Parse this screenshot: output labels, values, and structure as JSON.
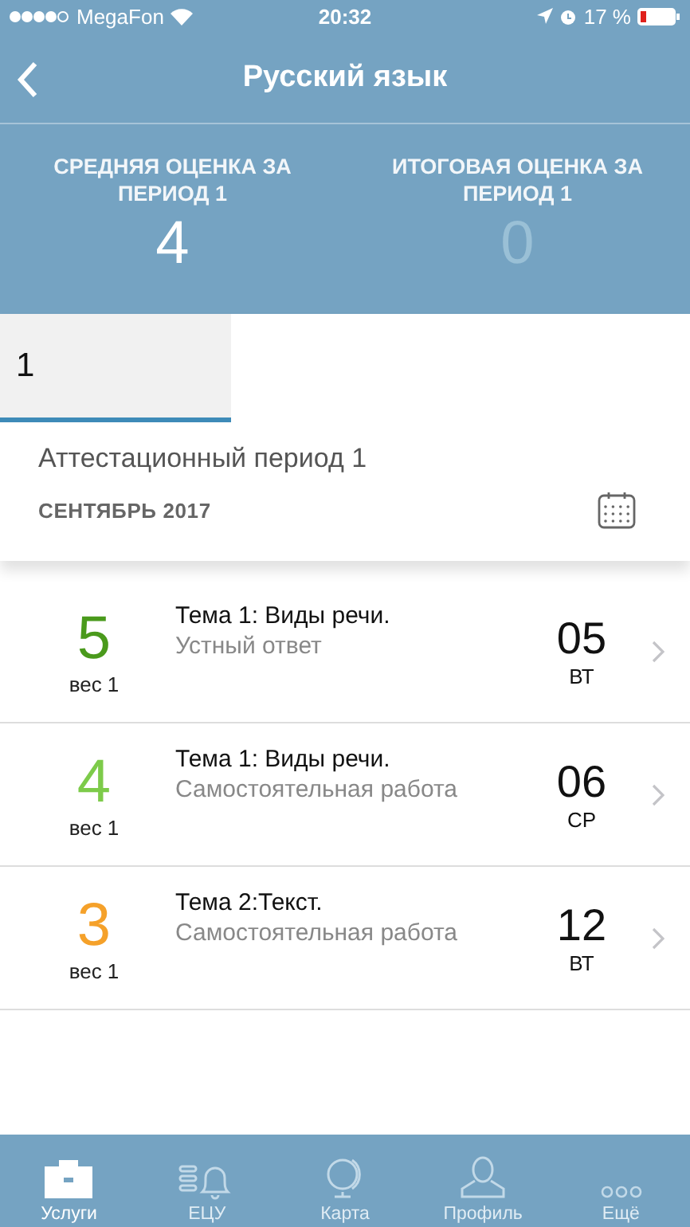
{
  "status_bar": {
    "carrier": "MegaFon",
    "time": "20:32",
    "battery": "17 %"
  },
  "nav": {
    "title": "Русский язык"
  },
  "summary": [
    {
      "label": "СРЕДНЯЯ ОЦЕНКА ЗА ПЕРИОД 1",
      "value": "4",
      "dimmed": false
    },
    {
      "label": "ИТОГОВАЯ ОЦЕНКА ЗА ПЕРИОД 1",
      "value": "0",
      "dimmed": true
    }
  ],
  "periods": [
    {
      "label": "1",
      "selected": true
    }
  ],
  "period_title": "Аттестационный период 1",
  "month": "СЕНТЯБРЬ 2017",
  "grades": [
    {
      "grade": "5",
      "color": "#4a9a1c",
      "weight": "вес 1",
      "topic": "Тема 1: Виды речи.",
      "type": "Устный ответ",
      "day": "05",
      "weekday": "ВТ"
    },
    {
      "grade": "4",
      "color": "#7dcb4a",
      "weight": "вес 1",
      "topic": "Тема 1: Виды речи.",
      "type": "Самостоятельная работа",
      "day": "06",
      "weekday": "СР"
    },
    {
      "grade": "3",
      "color": "#f5a12a",
      "weight": "вес 1",
      "topic": "Тема 2:Текст.",
      "type": "Самостоятельная работа",
      "day": "12",
      "weekday": "ВТ"
    }
  ],
  "tab_bar": [
    {
      "label": "Услуги",
      "kind": "briefcase",
      "selected": true
    },
    {
      "label": "ЕЦУ",
      "kind": "bell",
      "selected": false
    },
    {
      "label": "Карта",
      "kind": "globe",
      "selected": false
    },
    {
      "label": "Профиль",
      "kind": "person",
      "selected": false
    },
    {
      "label": "Ещё",
      "kind": "more",
      "selected": false
    }
  ]
}
